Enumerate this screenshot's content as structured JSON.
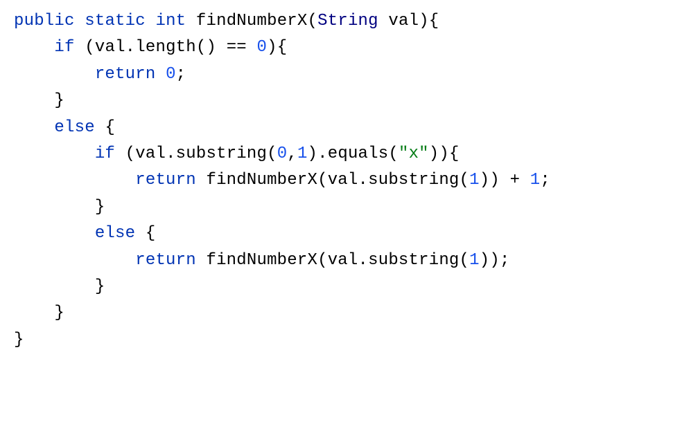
{
  "code": {
    "line1": {
      "kw_public": "public",
      "kw_static": "static",
      "kw_int": "int",
      "method": "findNumberX",
      "paren_open": "(",
      "type_string": "String",
      "param": "val",
      "paren_close_brace": "){"
    },
    "line2": {
      "indent": "    ",
      "kw_if": "if",
      "text_open": " (",
      "ident_val": "val",
      "dot_length": ".length()",
      "op_eq": " == ",
      "zero": "0",
      "close": "){"
    },
    "line3": {
      "indent": "        ",
      "kw_return": "return",
      "space": " ",
      "zero": "0",
      "semi": ";"
    },
    "line4": {
      "indent": "    ",
      "brace": "}"
    },
    "line5": {
      "indent": "    ",
      "kw_else": "else",
      "brace": " {"
    },
    "line6": {
      "indent": "        ",
      "kw_if": "if",
      "open": " (",
      "ident_val": "val",
      "dot_sub": ".substring(",
      "arg0": "0",
      "comma": ",",
      "arg1": "1",
      "close_sub": ").equals(",
      "str_x": "\"x\"",
      "close": ")){"
    },
    "line7": {
      "indent": "            ",
      "kw_return": "return",
      "space": " ",
      "call": "findNumberX(",
      "ident_val": "val",
      "dot_sub": ".substring(",
      "arg1": "1",
      "close": ")) + ",
      "one": "1",
      "semi": ";"
    },
    "line8": {
      "indent": "        ",
      "brace": "}"
    },
    "line9": {
      "indent": "        ",
      "kw_else": "else",
      "brace": " {"
    },
    "line10": {
      "indent": "            ",
      "kw_return": "return",
      "space": " ",
      "call": "findNumberX(",
      "ident_val": "val",
      "dot_sub": ".substring(",
      "arg1": "1",
      "close": "));"
    },
    "line11": {
      "indent": "        ",
      "brace": "}"
    },
    "line12": {
      "indent": "    ",
      "brace": "}"
    },
    "line13": {
      "brace": "}"
    }
  }
}
